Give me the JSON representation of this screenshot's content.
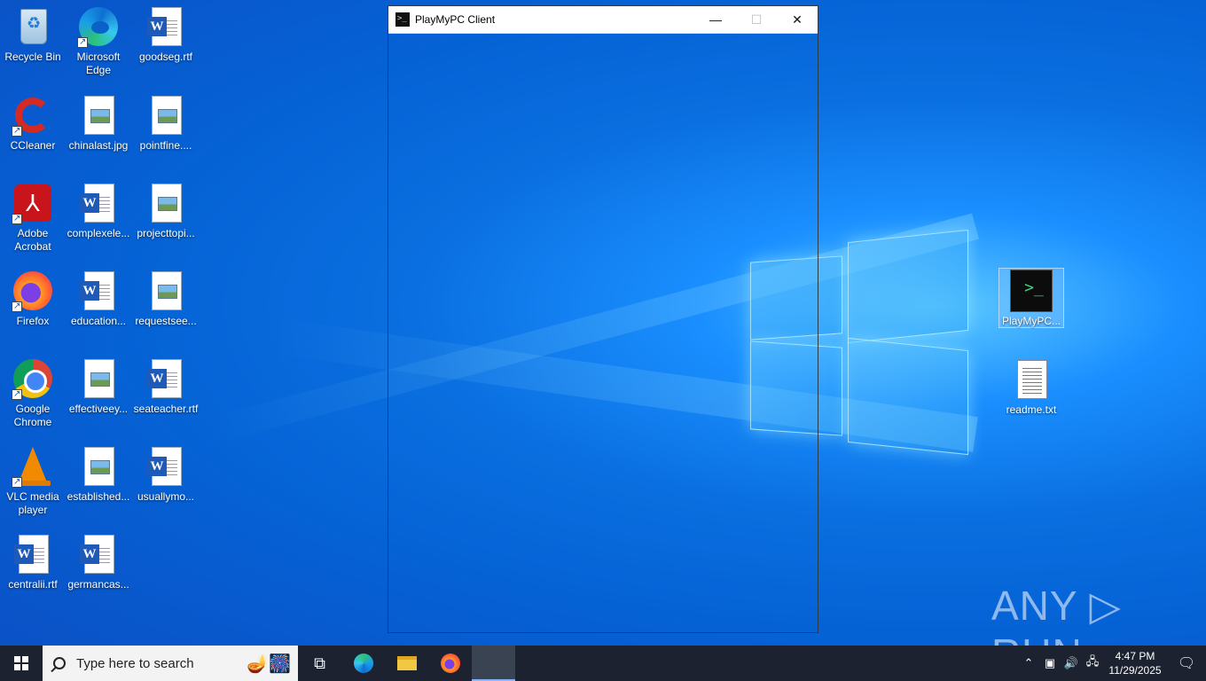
{
  "desktop": {
    "icons_left": [
      {
        "label": "Recycle Bin",
        "type": "recycle"
      },
      {
        "label": "Microsoft Edge",
        "type": "edge"
      },
      {
        "label": "goodseg.rtf",
        "type": "word"
      },
      {
        "label": "CCleaner",
        "type": "ccleaner"
      },
      {
        "label": "chinalast.jpg",
        "type": "image"
      },
      {
        "label": "pointfine....",
        "type": "image"
      },
      {
        "label": "Adobe Acrobat",
        "type": "acrobat"
      },
      {
        "label": "complexele...",
        "type": "word"
      },
      {
        "label": "projecttopi...",
        "type": "image"
      },
      {
        "label": "Firefox",
        "type": "firefox"
      },
      {
        "label": "education...",
        "type": "word"
      },
      {
        "label": "requestsee...",
        "type": "image"
      },
      {
        "label": "Google Chrome",
        "type": "chrome"
      },
      {
        "label": "effectiveey...",
        "type": "image"
      },
      {
        "label": "seateacher.rtf",
        "type": "word"
      },
      {
        "label": "VLC media player",
        "type": "vlc"
      },
      {
        "label": "established...",
        "type": "image"
      },
      {
        "label": "usuallymo...",
        "type": "word"
      },
      {
        "label": "centralii.rtf",
        "type": "word"
      },
      {
        "label": "germancas...",
        "type": "word"
      }
    ],
    "icons_right": [
      {
        "label": "PlayMyPC...",
        "type": "console"
      },
      {
        "label": "readme.txt",
        "type": "text"
      }
    ]
  },
  "window": {
    "title": "PlayMyPC Client",
    "minimize_glyph": "—",
    "maximize_glyph": "☐",
    "close_glyph": "✕"
  },
  "watermark": "ANY ▷ RUN",
  "taskbar": {
    "search_placeholder": "Type here to search",
    "time": "4:47 PM",
    "date": "11/29/2025"
  },
  "colors": {
    "taskbar": "#1c2230",
    "desktop_blue": "#0a6fe0"
  }
}
